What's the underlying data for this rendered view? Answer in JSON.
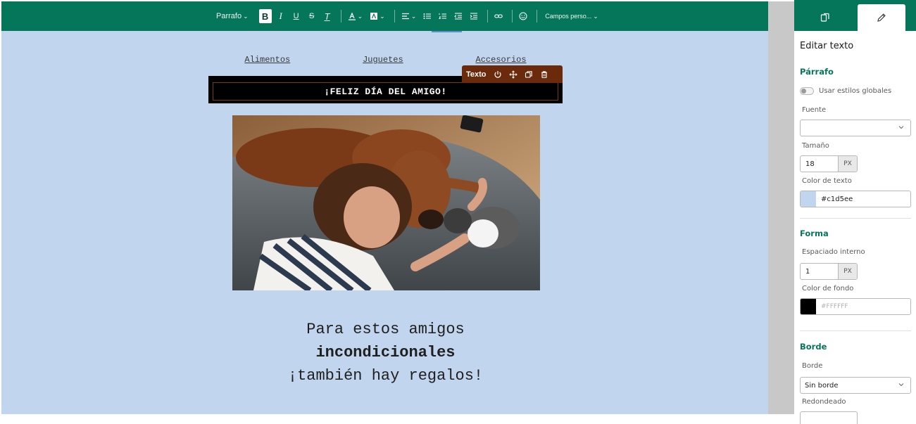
{
  "toolbar": {
    "paragraph_label": "Parrafo",
    "bold_label": "B",
    "italic_label": "I",
    "underline_label": "U",
    "strike_label": "S",
    "clear_format_label": "T",
    "custom_fields_label": "Campos perso..."
  },
  "email": {
    "nav": [
      "Alimentos",
      "Juguetes",
      "Accesorios"
    ],
    "banner_text": "¡FELIZ DÍA DEL AMIGO!",
    "block_toolbar_label": "Texto",
    "message_line1": "Para estos amigos",
    "message_line2": "incondicionales",
    "message_line3": "¡también hay regalos!",
    "canvas_color": "#c1d5ee"
  },
  "panel": {
    "title": "Editar texto",
    "paragraph_section": "Párrafo",
    "global_styles_label": "Usar estilos globales",
    "font_label": "Fuente",
    "font_value": "",
    "size_label": "Tamaño",
    "size_value": "18",
    "size_unit": "PX",
    "text_color_label": "Color de texto",
    "text_color_value": "#c1d5ee",
    "shape_section": "Forma",
    "padding_label": "Espaciado interno",
    "padding_value": "1",
    "padding_unit": "PX",
    "bg_color_label": "Color de fondo",
    "bg_color_placeholder": "#FFFFFF",
    "bg_color_swatch": "#000000",
    "border_section": "Borde",
    "border_label": "Borde",
    "border_value": "Sin borde",
    "radius_label": "Redondeado"
  },
  "colors": {
    "brand_green": "#06765a",
    "block_toolbar": "#6b2a0b"
  }
}
